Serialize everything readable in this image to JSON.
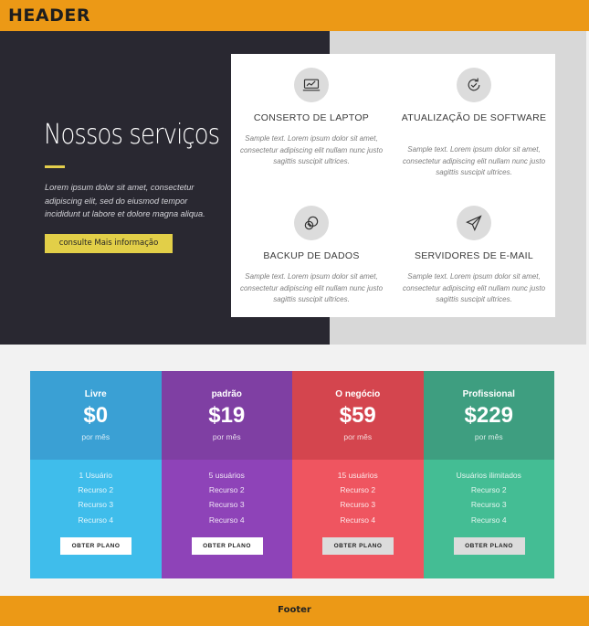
{
  "header": {
    "title": "HEADER"
  },
  "hero": {
    "title": "Nossos serviços",
    "text": "Lorem ipsum dolor sit amet, consectetur adipiscing elit, sed do eiusmod tempor incididunt ut labore et dolore magna aliqua.",
    "button_label": "consulte Mais informação"
  },
  "services": [
    {
      "icon": "laptop-icon",
      "title": "CONSERTO DE LAPTOP",
      "text": "Sample text. Lorem ipsum dolor sit amet, consectetur adipiscing elit nullam nunc justo sagittis suscipit ultrices."
    },
    {
      "icon": "refresh-check-icon",
      "title": "ATUALIZAÇÃO DE SOFTWARE",
      "text": "Sample text. Lorem ipsum dolor sit amet, consectetur adipiscing elit nullam nunc justo sagittis suscipit ultrices."
    },
    {
      "icon": "coins-icon",
      "title": "BACKUP DE DADOS",
      "text": "Sample text. Lorem ipsum dolor sit amet, consectetur adipiscing elit nullam nunc justo sagittis suscipit ultrices."
    },
    {
      "icon": "paper-plane-icon",
      "title": "SERVIDORES DE E-MAIL",
      "text": "Sample text. Lorem ipsum dolor sit amet, consectetur adipiscing elit nullam nunc justo sagittis suscipit ultrices."
    }
  ],
  "plans": [
    {
      "name": "Livre",
      "price": "$0",
      "period": "por mês",
      "features": [
        "1 Usuário",
        "Recurso 2",
        "Recurso 3",
        "Recurso 4"
      ],
      "button_label": "OBTER PLANO",
      "color_top": "#3aa0d4",
      "color_bottom": "#3fbdeb",
      "button_bg": "#ffffff"
    },
    {
      "name": "padrão",
      "price": "$19",
      "period": "por mês",
      "features": [
        "5 usuários",
        "Recurso 2",
        "Recurso 3",
        "Recurso 4"
      ],
      "button_label": "OBTER PLANO",
      "color_top": "#7f3fa3",
      "color_bottom": "#8e43b8",
      "button_bg": "#ffffff"
    },
    {
      "name": "O negócio",
      "price": "$59",
      "period": "por mês",
      "features": [
        "15 usuários",
        "Recurso 2",
        "Recurso 3",
        "Recurso 4"
      ],
      "button_label": "OBTER PLANO",
      "color_top": "#d4454e",
      "color_bottom": "#ef5560",
      "button_bg": "#dcdcdc"
    },
    {
      "name": "Profissional",
      "price": "$229",
      "period": "por mês",
      "features": [
        "Usuários ilimitados",
        "Recurso 2",
        "Recurso 3",
        "Recurso 4"
      ],
      "button_label": "OBTER PLANO",
      "color_top": "#3e9e80",
      "color_bottom": "#44bd94",
      "button_bg": "#dcdcdc"
    }
  ],
  "footer": {
    "title": "Footer"
  },
  "colors": {
    "accent": "#ec9916",
    "dark": "#292831",
    "yellow": "#e2cf48"
  }
}
